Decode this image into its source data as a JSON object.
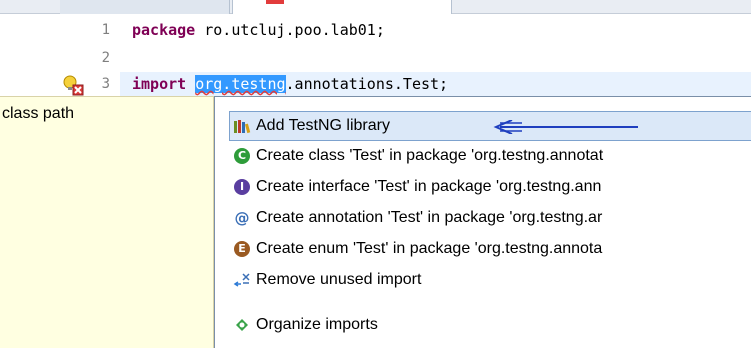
{
  "editor": {
    "lines": [
      {
        "number": "1",
        "keyword": "package",
        "rest": " ro.utcluj.poo.lab01;"
      },
      {
        "number": "2"
      },
      {
        "number": "3",
        "keyword": "import",
        "selected": "org.testng",
        "rest": ".annotations.Test;"
      }
    ]
  },
  "description": {
    "text": "class path"
  },
  "proposals": [
    {
      "label": "Add TestNG library",
      "icon": "library-icon"
    },
    {
      "label": "Create class 'Test' in package 'org.testng.annotat",
      "icon": "class-icon",
      "badge": "C",
      "color": "#2e9c3a"
    },
    {
      "label": "Create interface 'Test' in package 'org.testng.ann",
      "icon": "interface-icon",
      "badge": "I",
      "color": "#5a3ea0"
    },
    {
      "label": "Create annotation 'Test' in package 'org.testng.ar",
      "icon": "annotation-icon",
      "badge": "@",
      "color": "#3b6fb6"
    },
    {
      "label": "Create enum 'Test' in package 'org.testng.annota",
      "icon": "enum-icon",
      "badge": "E",
      "color": "#9a5a22"
    },
    {
      "label": "Remove unused import",
      "icon": "remove-import-icon"
    },
    {
      "label": "Organize imports",
      "icon": "organize-imports-icon"
    }
  ]
}
